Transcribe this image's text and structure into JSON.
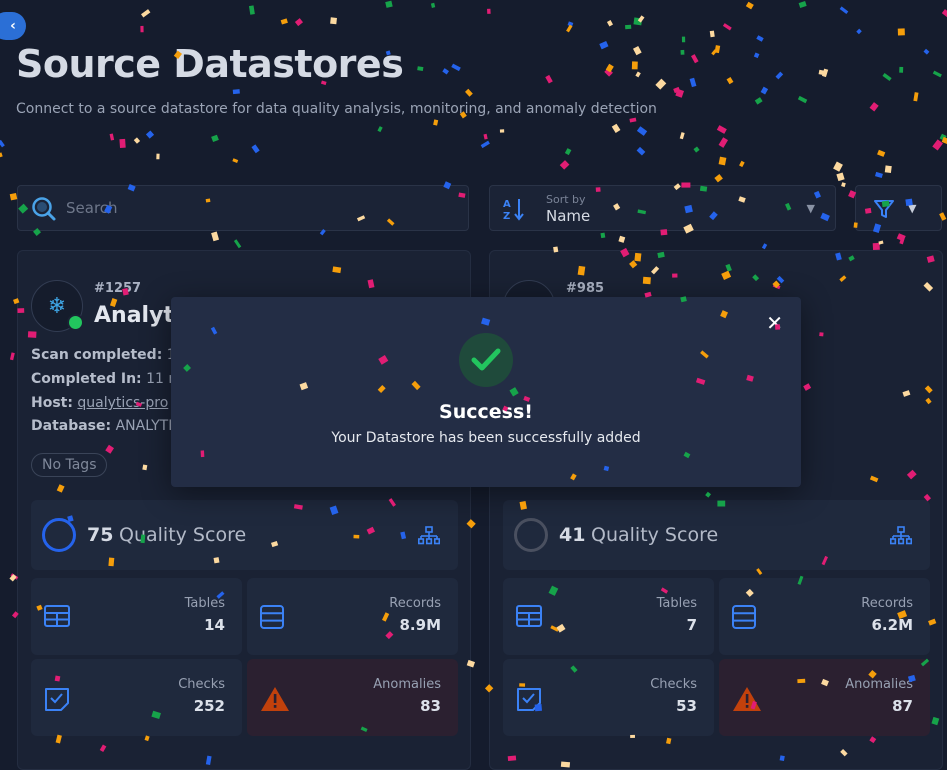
{
  "header": {
    "back_icon": "chevron-left-icon",
    "title": "Source Datastores",
    "subtitle": "Connect to a source datastore for data quality analysis, monitoring, and anomaly detection"
  },
  "toolbar": {
    "search_placeholder": "Search",
    "sort_label": "Sort by",
    "sort_value": "Name",
    "filter_icon": "filter-icon"
  },
  "cards": [
    {
      "id": "#1257",
      "name": "Analyti",
      "status_color": "#22c55e",
      "scan_label": "Scan completed:",
      "scan_value": "1",
      "completed_label": "Completed In:",
      "completed_value": "11 m",
      "host_label": "Host:",
      "host_value": "qualytics-pro",
      "db_label": "Database:",
      "db_value": "ANALYTI",
      "tag": "No Tags",
      "quality_score": "75",
      "quality_label": "Quality Score",
      "tables_label": "Tables",
      "tables_value": "14",
      "records_label": "Records",
      "records_value": "8.9M",
      "checks_label": "Checks",
      "checks_value": "252",
      "anomalies_label": "Anomalies",
      "anomalies_value": "83"
    },
    {
      "id": "#985",
      "quality_score": "41",
      "quality_label": "Quality Score",
      "tables_label": "Tables",
      "tables_value": "7",
      "records_label": "Records",
      "records_value": "6.2M",
      "checks_label": "Checks",
      "checks_value": "53",
      "anomalies_label": "Anomalies",
      "anomalies_value": "87"
    }
  ],
  "dialog": {
    "title": "Success!",
    "message": "Your Datastore has been successfully added",
    "close_icon": "close-icon"
  },
  "colors": {
    "accent": "#2b6fd6",
    "success": "#22c55e",
    "danger": "#c2410c",
    "confetti": [
      "#e11d74",
      "#16a34a",
      "#f59e0b",
      "#2563eb",
      "#fcd9a0"
    ]
  }
}
